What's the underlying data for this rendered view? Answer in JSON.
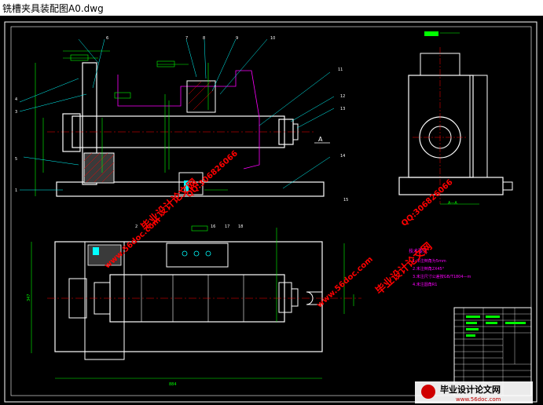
{
  "window": {
    "title": "铣槽夹具装配图A0.dwg"
  },
  "drawing": {
    "part_numbers": [
      "6",
      "7",
      "8",
      "9",
      "10",
      "11",
      "12",
      "13",
      "14",
      "15",
      "16",
      "17",
      "18",
      "4",
      "3",
      "5",
      "1",
      "2"
    ],
    "tech_notes": {
      "heading": "技术要求",
      "items": [
        "1.未注倒角为5mm",
        "2.未注倒角2X45°",
        "3.未注尺寸公差按GB/T1804—m",
        "4.未注圆角R1"
      ]
    },
    "section_label": "A",
    "view_label": "A—A",
    "dim_overall_width": "884",
    "dim_height": "347"
  },
  "watermark": {
    "site": "www.56doc.com",
    "name": "毕业设计论文网",
    "qq": "QQ:306826066",
    "corner_logo": "毕业设计论文网",
    "corner_url": "www.56doc.com"
  },
  "colors": {
    "background": "#000000",
    "lines_white": "#ffffff",
    "lines_green": "#00ff00",
    "lines_cyan": "#00ffff",
    "lines_magenta": "#ff00ff",
    "lines_red": "#ff0000",
    "watermark_red": "#ff0000"
  }
}
